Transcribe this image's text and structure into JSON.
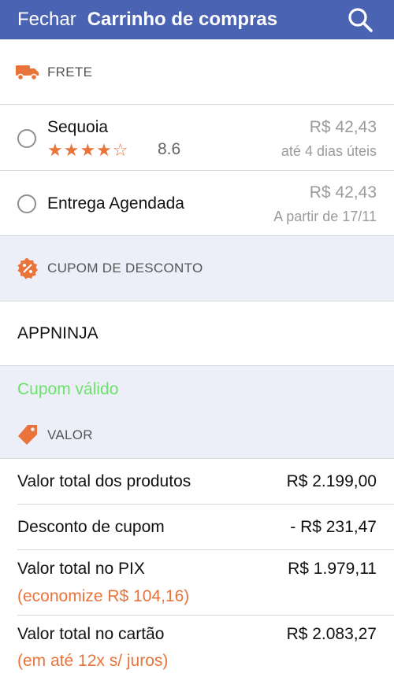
{
  "navbar": {
    "close_label": "Fechar",
    "title": "Carrinho de compras",
    "search_icon": "search-icon"
  },
  "shipping": {
    "header": "FRETE",
    "icon": "truck-icon",
    "options": [
      {
        "name": "Sequoia",
        "stars": "★★★★☆",
        "rating": "8.6",
        "rating_value": 4,
        "price": "R$ 42,43",
        "detail": "até 4 dias úteis"
      },
      {
        "name": "Entrega Agendada",
        "price": "R$ 42,43",
        "detail": "A partir de 17/11"
      }
    ]
  },
  "coupon": {
    "header": "CUPOM DE DESCONTO",
    "icon": "discount-badge-icon",
    "code": "APPNINJA",
    "status": "Cupom válido"
  },
  "value": {
    "header": "VALOR",
    "icon": "price-tag-icon",
    "rows": [
      {
        "label": "Valor total dos produtos",
        "amount": "R$ 2.199,00"
      },
      {
        "label": "Desconto de cupom",
        "amount": "- R$ 231,47"
      },
      {
        "label": "Valor total no PIX",
        "amount": "R$ 1.979,11",
        "note": "(economize R$ 104,16)"
      },
      {
        "label": "Valor total no cartão",
        "amount": "R$ 2.083,27",
        "note": "(em até 12x s/ juros)"
      }
    ]
  },
  "colors": {
    "navbar": "#4a63b3",
    "accent": "#e8743b",
    "valid": "#6ee06b",
    "section_bg": "#eceef8"
  }
}
